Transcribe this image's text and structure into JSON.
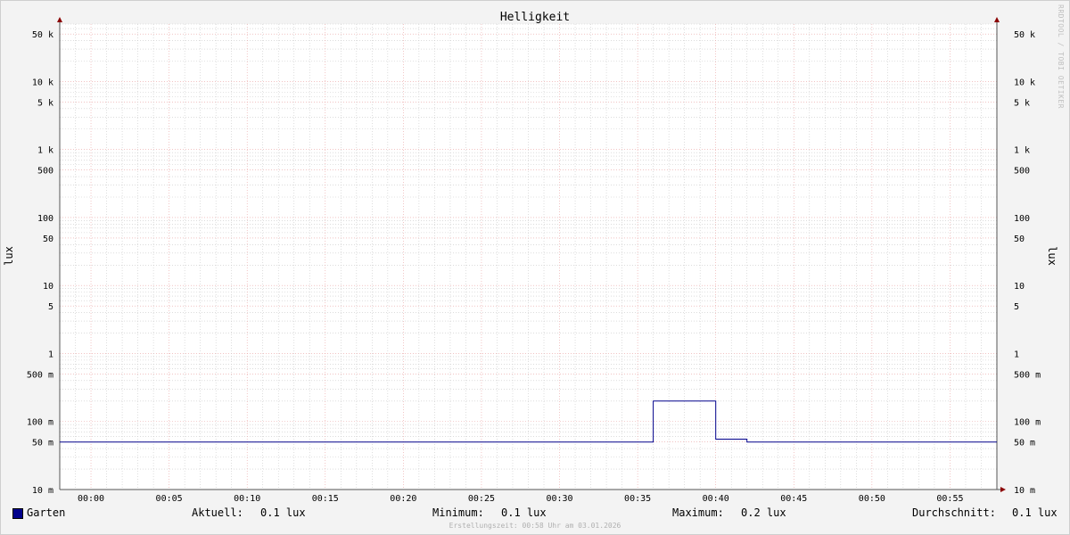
{
  "chart_data": {
    "type": "line",
    "title": "Helligkeit",
    "ylabel": "lux",
    "y_scale": "log",
    "ylim": [
      0.01,
      70000
    ],
    "y_ticks": [
      {
        "value": 50000,
        "label": "50 k"
      },
      {
        "value": 10000,
        "label": "10 k"
      },
      {
        "value": 5000,
        "label": "5 k"
      },
      {
        "value": 1000,
        "label": "1 k"
      },
      {
        "value": 500,
        "label": "500"
      },
      {
        "value": 100,
        "label": "100"
      },
      {
        "value": 50,
        "label": "50"
      },
      {
        "value": 10,
        "label": "10"
      },
      {
        "value": 5,
        "label": "5"
      },
      {
        "value": 1,
        "label": "1"
      },
      {
        "value": 0.5,
        "label": "500 m"
      },
      {
        "value": 0.1,
        "label": "100 m"
      },
      {
        "value": 0.05,
        "label": "50 m"
      },
      {
        "value": 0.01,
        "label": "10 m"
      }
    ],
    "x_unit": "minutes",
    "xlim": [
      -2,
      58
    ],
    "x_ticks": [
      {
        "value": 0,
        "label": "00:00"
      },
      {
        "value": 5,
        "label": "00:05"
      },
      {
        "value": 10,
        "label": "00:10"
      },
      {
        "value": 15,
        "label": "00:15"
      },
      {
        "value": 20,
        "label": "00:20"
      },
      {
        "value": 25,
        "label": "00:25"
      },
      {
        "value": 30,
        "label": "00:30"
      },
      {
        "value": 35,
        "label": "00:35"
      },
      {
        "value": 40,
        "label": "00:40"
      },
      {
        "value": 45,
        "label": "00:45"
      },
      {
        "value": 50,
        "label": "00:50"
      },
      {
        "value": 55,
        "label": "00:55"
      }
    ],
    "grid": true,
    "series": [
      {
        "name": "Garten",
        "color": "#00008b",
        "x": [
          -2,
          36,
          36,
          40,
          40,
          42,
          42,
          58
        ],
        "values": [
          0.05,
          0.05,
          0.2,
          0.2,
          0.055,
          0.055,
          0.05,
          0.05
        ]
      }
    ]
  },
  "legend": {
    "series_name": "Garten",
    "aktuell_label": "Aktuell:",
    "aktuell_value": "0.1 lux",
    "minimum_label": "Minimum:",
    "minimum_value": "0.1 lux",
    "maximum_label": "Maximum:",
    "maximum_value": "0.2 lux",
    "durchschnitt_label": "Durchschnitt:",
    "durchschnitt_value": "0.1 lux"
  },
  "footer": "Erstellungszeit: 00:58 Uhr am 03.01.2026",
  "credit": "RRDTOOL / TOBI OETIKER",
  "colors": {
    "background": "#f3f3f3",
    "plot_background": "#ffffff",
    "major_grid": "#e9a0a0",
    "minor_grid": "#c8c8c8",
    "series": "#00008b",
    "arrow": "#8b0000"
  }
}
